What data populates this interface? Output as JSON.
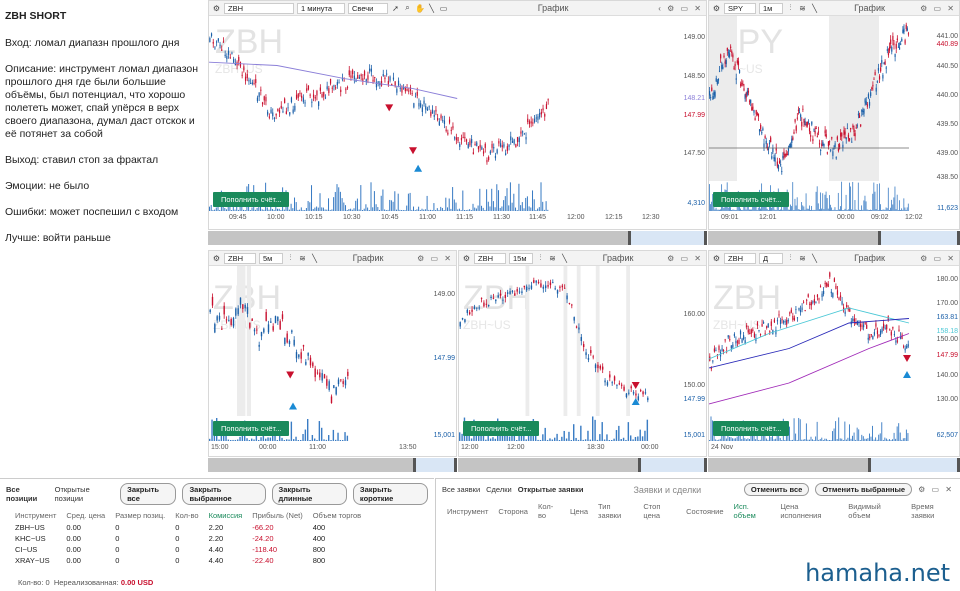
{
  "notes": {
    "title": "ZBH SHORT",
    "entry": "Вход: ломал диапазн прошлого дня",
    "description": "Описание: инструмент ломал диапазон прошлого дня где были большие объёмы, был потенциал, что хорошо полететь может, спай упёрся в верх своего диапазона, думал даст отскок и её потянет за собой",
    "exit": "Выход: ставил стоп за фрактал",
    "emotions": "Эмоции: не было",
    "mistakes": "Ошибки: может поспешил с входом",
    "better": "Лучше: войти раньше"
  },
  "toolbar_common": {
    "title": "График",
    "candles": "Свечи",
    "deposit": "Пополнить счёт..."
  },
  "charts": {
    "main": {
      "symbol": "ZBH",
      "timeframe": "1 минута",
      "wm": "ZBH",
      "wm_sub": "ZBH~US",
      "prices": [
        "149.00",
        "148.50",
        "148.21",
        "147.99",
        "147.50"
      ],
      "times": [
        "09:45",
        "10:00",
        "10:15",
        "10:30",
        "10:45",
        "11:00",
        "11:15",
        "11:30",
        "11:45",
        "12:00",
        "12:15",
        "12:30"
      ],
      "volume": "4,310"
    },
    "spy": {
      "symbol": "SPY",
      "timeframe": "1м",
      "wm": "SPY",
      "wm_sub": "SPY~US",
      "prices": [
        "441.00",
        "440.89",
        "440.50",
        "440.00",
        "439.50",
        "439.00",
        "438.50"
      ],
      "times": [
        "09:01",
        "12:01",
        "00:00",
        "09:02",
        "12:02"
      ],
      "volume": "11,623"
    },
    "five": {
      "symbol": "ZBH",
      "timeframe": "5м",
      "wm": "ZBH",
      "wm_sub": "ZBH~US",
      "prices": [
        "149.00",
        "147.99"
      ],
      "times": [
        "15:00",
        "00:00",
        "11:00",
        "13:50"
      ],
      "volume": "15,001"
    },
    "fifteen": {
      "symbol": "ZBH",
      "timeframe": "15м",
      "wm": "ZBH",
      "wm_sub": "ZBH~US",
      "prices": [
        "160.00",
        "150.00",
        "147.99"
      ],
      "times": [
        "12:00",
        "12:00",
        "18:30",
        "00:00"
      ],
      "volume": "15,001"
    },
    "daily": {
      "symbol": "ZBH",
      "timeframe": "Д",
      "wm": "ZBH",
      "wm_sub": "ZBH~US",
      "prices": [
        "180.00",
        "170.00",
        "163.81",
        "158.18",
        "150.00",
        "147.99",
        "140.00",
        "130.00"
      ],
      "times": [
        "24 Nov"
      ],
      "volume": "62,507"
    }
  },
  "positions": {
    "tabs": [
      "Все позиции",
      "Открытые позиции"
    ],
    "buttons": [
      "Закрыть все",
      "Закрыть выбранное",
      "Закрыть длинные",
      "Закрыть короткие"
    ],
    "columns": [
      "Инструмент",
      "Сред. цена",
      "Размер позиц.",
      "Кол-во",
      "Комиссия",
      "Прибыль (Net)",
      "Объем торгов"
    ],
    "rows": [
      [
        "ZBH~US",
        "0.00",
        "0",
        "0",
        "2.20",
        "-66.20",
        "400"
      ],
      [
        "KHC~US",
        "0.00",
        "0",
        "0",
        "2.20",
        "-24.20",
        "400"
      ],
      [
        "CI~US",
        "0.00",
        "0",
        "0",
        "4.40",
        "-118.40",
        "800"
      ],
      [
        "XRAY~US",
        "0.00",
        "0",
        "0",
        "4.40",
        "-22.40",
        "800"
      ]
    ],
    "footer_count": "Кол-во: 0",
    "footer_unreal_label": "Нереализованная:",
    "footer_unreal_value": "0.00 USD"
  },
  "orders": {
    "title": "Заявки и сделки",
    "tabs": [
      "Все заявки",
      "Сделки",
      "Открытые заявки"
    ],
    "buttons": [
      "Отменить все",
      "Отменить выбранные"
    ],
    "columns": [
      "Инструмент",
      "Сторона",
      "Кол-во",
      "Цена",
      "Тип заявки",
      "Стоп цена",
      "Состояние",
      "Исп. объем",
      "Цена исполнения",
      "Видимый объем",
      "Время заявки"
    ]
  },
  "brand": "hamaha.net",
  "colors": {
    "up": "#1a5fa8",
    "down": "#c8102e",
    "deposit": "#1a8a5b",
    "ma": "#8b7fd8"
  }
}
